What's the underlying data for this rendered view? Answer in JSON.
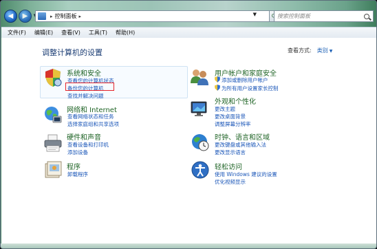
{
  "toolbar": {
    "address_text": "控制面板",
    "search_placeholder": "搜索控制面板"
  },
  "menu": [
    "文件(F)",
    "编辑(E)",
    "查看(V)",
    "工具(T)",
    "帮助(H)"
  ],
  "main": {
    "title": "调整计算机的设置",
    "view_label": "查看方式:",
    "view_value": "类别"
  },
  "categories": {
    "system": {
      "title": "系统和安全",
      "links": [
        "查看您的计算机状态",
        "备份您的计算机",
        "查找并解决问题"
      ]
    },
    "network": {
      "title": "网络和 Internet",
      "links": [
        "查看网络状态和任务",
        "选择家庭组和共享选项"
      ]
    },
    "hardware": {
      "title": "硬件和声音",
      "links": [
        "查看设备和打印机",
        "添加设备"
      ]
    },
    "programs": {
      "title": "程序",
      "links": [
        "卸载程序"
      ]
    },
    "users": {
      "title": "用户帐户和家庭安全",
      "links": [
        "添加或删除用户帐户",
        "为所有用户设置家长控制"
      ]
    },
    "appearance": {
      "title": "外观和个性化",
      "links": [
        "更改主题",
        "更改桌面背景",
        "调整屏幕分辨率"
      ]
    },
    "clock": {
      "title": "时钟、语言和区域",
      "links": [
        "更改键盘或其他输入法",
        "更改显示语言"
      ]
    },
    "access": {
      "title": "轻松访问",
      "links": [
        "使用 Windows 建议的设置",
        "优化视频显示"
      ]
    }
  }
}
